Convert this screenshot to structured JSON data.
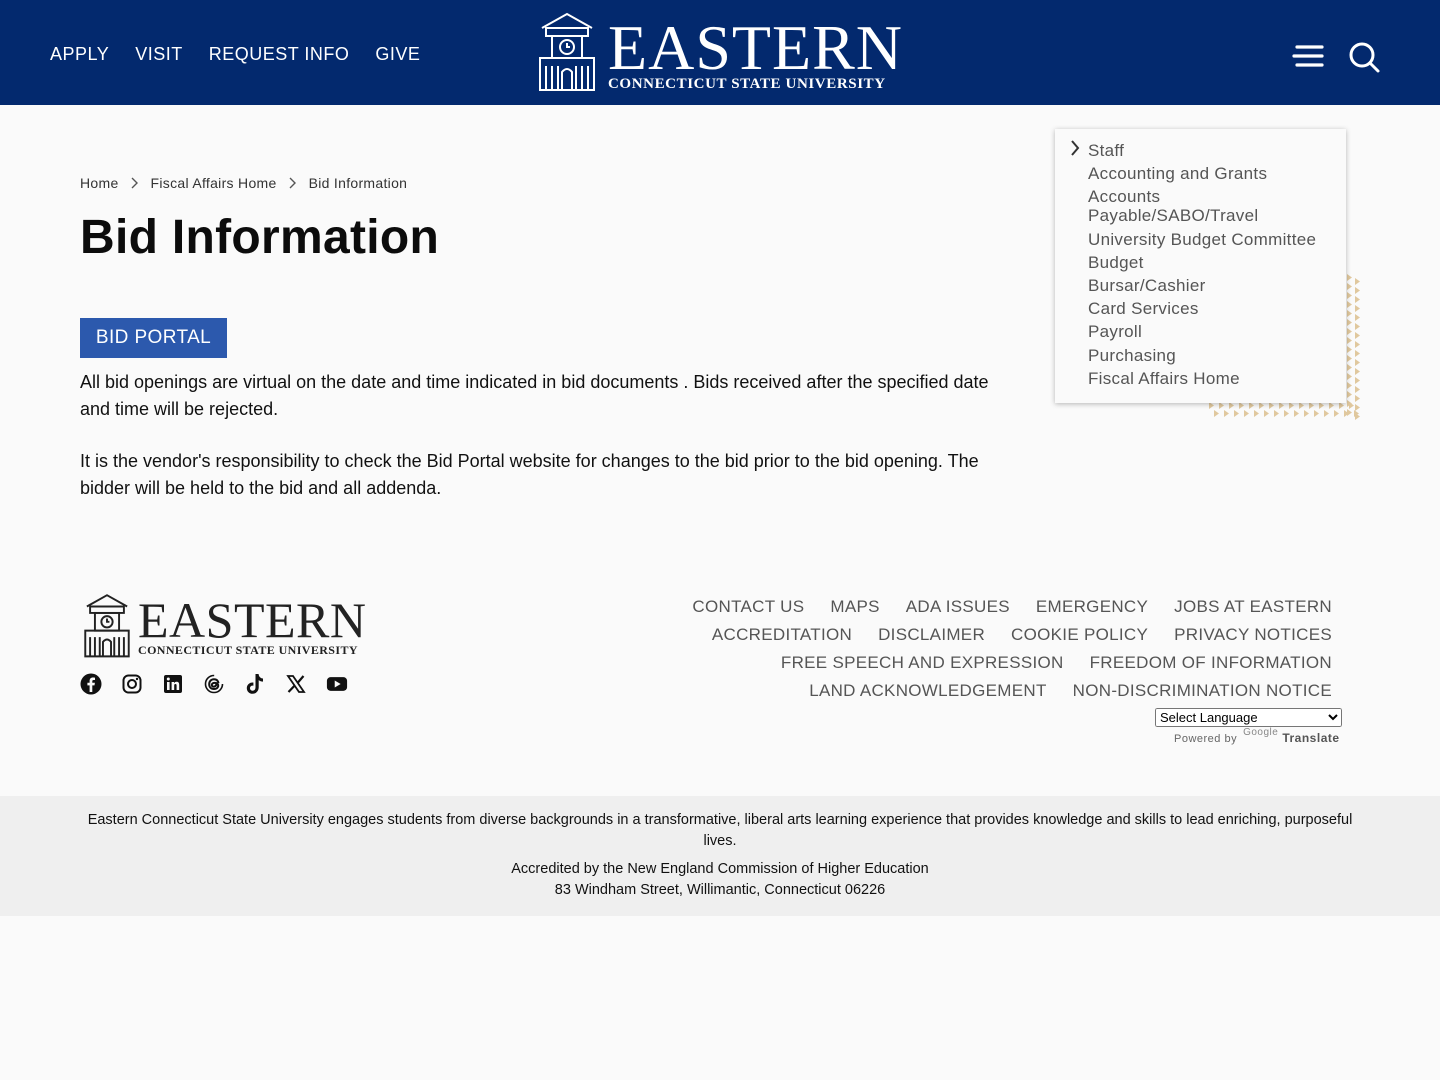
{
  "header": {
    "nav": [
      "APPLY",
      "VISIT",
      "REQUEST INFO",
      "GIVE"
    ],
    "logo_word": "EASTERN",
    "logo_sub": "CONNECTICUT STATE UNIVERSITY",
    "icons": [
      "hamburger-menu-icon",
      "search-icon"
    ]
  },
  "breadcrumb": [
    "Home",
    "Fiscal Affairs Home",
    "Bid Information"
  ],
  "page": {
    "title": "Bid Information",
    "button": "BID PORTAL",
    "paragraphs": [
      "All bid openings are virtual on the date and time indicated in bid documents . Bids received after the specified date and time will be rejected.",
      "It is the vendor's responsibility to check the Bid Portal website for changes to the bid prior to the bid opening. The bidder will be held to the bid and all addenda."
    ]
  },
  "sidemenu": {
    "items": [
      "Staff",
      "Accounting and Grants",
      "Accounts Payable/SABO/Travel",
      "University Budget Committee",
      "Budget",
      "Bursar/Cashier",
      "Card Services",
      "Payroll",
      "Purchasing",
      "Fiscal Affairs Home"
    ]
  },
  "footer": {
    "logo_word": "EASTERN",
    "logo_sub": "CONNECTICUT STATE UNIVERSITY",
    "social_icons": [
      "facebook-icon",
      "instagram-icon",
      "linkedin-icon",
      "threads-icon",
      "tiktok-icon",
      "x-icon",
      "youtube-icon"
    ],
    "link_rows": [
      [
        "CONTACT US",
        "MAPS",
        "ADA ISSUES",
        "EMERGENCY",
        "JOBS AT EASTERN"
      ],
      [
        "ACCREDITATION",
        "DISCLAIMER",
        "COOKIE POLICY",
        "PRIVACY NOTICES"
      ],
      [
        "FREE SPEECH AND EXPRESSION",
        "FREEDOM OF INFORMATION"
      ],
      [
        "LAND ACKNOWLEDGEMENT",
        "NON-DISCRIMINATION NOTICE"
      ]
    ],
    "language_select": "Select Language",
    "powered_by": "Powered by",
    "google": "Google",
    "translate": "Translate",
    "mission": "Eastern Connecticut State University engages students from diverse backgrounds in a transformative, liberal arts learning experience that provides knowledge and skills to lead enriching, purposeful lives.",
    "accredited": "Accredited by the New England Commission of Higher Education",
    "address": "83 Windham Street, Willimantic, Connecticut 06226"
  },
  "colors": {
    "header_bg": "#03296e",
    "button_bg": "#2c59ad",
    "dots": "#e0c89e"
  }
}
